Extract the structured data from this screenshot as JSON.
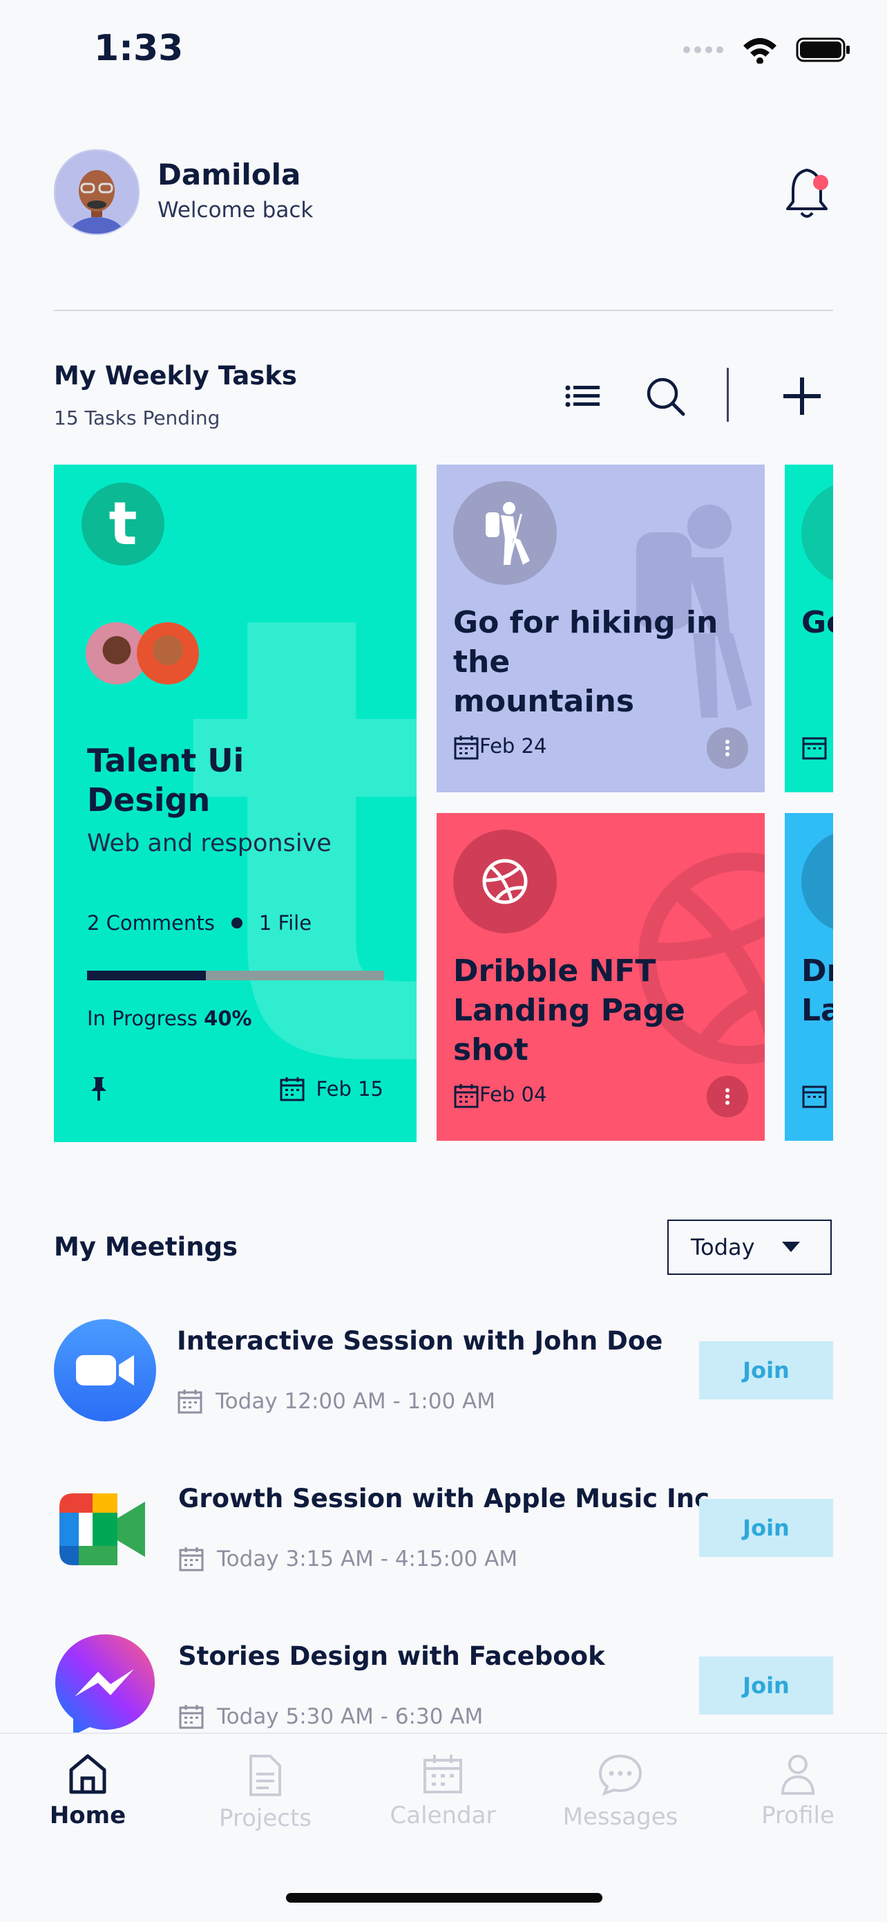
{
  "status_bar": {
    "time": "1:33"
  },
  "header": {
    "name": "Damilola",
    "subtitle": "Welcome back"
  },
  "weekly_tasks": {
    "title": "My Weekly Tasks",
    "subtitle": "15 Tasks Pending",
    "featured": {
      "logo_letter": "t",
      "title_line1": "Talent Ui",
      "title_line2": "Design",
      "subtitle": "Web and responsive",
      "comments": "2 Comments",
      "files": "1 File",
      "progress_label": "In Progress",
      "progress_value": "40%",
      "progress_fraction": 0.4,
      "date": "Feb 15"
    },
    "cards": [
      {
        "title_line1": "Go for hiking in the",
        "title_line2": "mountains",
        "date": "Feb 24",
        "color": "#B8C0EE",
        "icon": "hiker-icon"
      },
      {
        "title_line1": "Dribble NFT",
        "title_line2": "Landing Page shot",
        "date": "Feb 04",
        "color": "#FE546E",
        "icon": "dribbble-icon"
      }
    ],
    "peek_cards": [
      {
        "title_line1": "Go",
        "color": "#03E9C6"
      },
      {
        "title_line1": "Dr",
        "title_line2": "La",
        "color": "#2FBDF6"
      }
    ]
  },
  "meetings": {
    "title": "My Meetings",
    "filter": "Today",
    "items": [
      {
        "title": "Interactive Session with John Doe",
        "time": "Today 12:00 AM - 1:00 AM",
        "join": "Join",
        "icon": "zoom-icon"
      },
      {
        "title": "Growth Session with Apple Music Inc.",
        "time": "Today 3:15 AM - 4:15:00 AM",
        "join": "Join",
        "icon": "google-meet-icon"
      },
      {
        "title": "Stories Design with Facebook",
        "time": "Today 5:30 AM - 6:30 AM",
        "join": "Join",
        "icon": "messenger-icon"
      }
    ]
  },
  "tabs": [
    {
      "label": "Home",
      "active": true
    },
    {
      "label": "Projects",
      "active": false
    },
    {
      "label": "Calendar",
      "active": false
    },
    {
      "label": "Messages",
      "active": false
    },
    {
      "label": "Profile",
      "active": false
    }
  ],
  "colors": {
    "primary": "#0E1B3D",
    "teal": "#03E9C6",
    "lavender": "#B8C0EE",
    "coral": "#FE546E",
    "sky": "#2FBDF6",
    "join_bg": "#C9ECF8",
    "join_text": "#2EA8DB"
  }
}
